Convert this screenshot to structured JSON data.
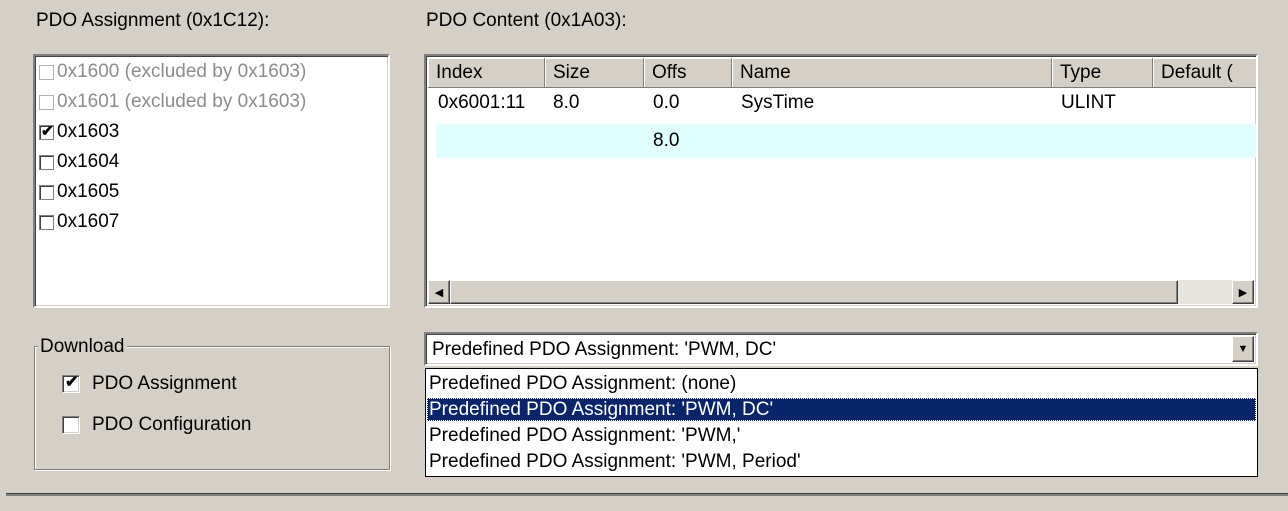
{
  "assignment": {
    "label": "PDO Assignment (0x1C12):",
    "items": [
      {
        "label": "0x1600 (excluded by 0x1603)",
        "checked": false,
        "disabled": true
      },
      {
        "label": "0x1601 (excluded by 0x1603)",
        "checked": false,
        "disabled": true
      },
      {
        "label": "0x1603",
        "checked": true,
        "disabled": false
      },
      {
        "label": "0x1604",
        "checked": false,
        "disabled": false
      },
      {
        "label": "0x1605",
        "checked": false,
        "disabled": false
      },
      {
        "label": "0x1607",
        "checked": false,
        "disabled": false
      }
    ]
  },
  "content": {
    "label": "PDO Content (0x1A03):",
    "columns": [
      "Index",
      "Size",
      "Offs",
      "Name",
      "Type",
      "Default ("
    ],
    "rows": [
      {
        "index": "0x6001:11",
        "size": "8.0",
        "offs": "0.0",
        "name": "SysTime",
        "type": "ULINT",
        "default": ""
      },
      {
        "index": "",
        "size": "",
        "offs": "8.0",
        "name": "",
        "type": "",
        "default": ""
      }
    ]
  },
  "download": {
    "title": "Download",
    "pdo_assignment": {
      "label": "PDO Assignment",
      "checked": true
    },
    "pdo_configuration": {
      "label": "PDO Configuration",
      "checked": false
    }
  },
  "predefined": {
    "selected": "Predefined PDO Assignment: 'PWM, DC'",
    "options": [
      "Predefined PDO Assignment: (none)",
      "Predefined PDO Assignment: 'PWM, DC'",
      "Predefined PDO Assignment: 'PWM,'",
      "Predefined PDO Assignment: 'PWM, Period'"
    ],
    "highlighted_index": 1
  },
  "icons": {
    "check": "✔",
    "arrow_left": "◀",
    "arrow_right": "▶",
    "arrow_down": "▼"
  },
  "colors": {
    "window_bg": "#d4d0c8",
    "selection_bg": "#0a246a",
    "row_highlight": "#e0ffff",
    "disabled_text": "#8c8c8c"
  }
}
